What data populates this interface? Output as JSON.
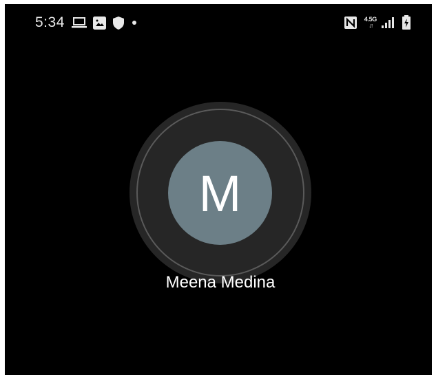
{
  "status_bar": {
    "time": "5:34",
    "left_icons": [
      "laptop-icon",
      "image-icon",
      "shield-icon",
      "dot-icon"
    ],
    "network_type": "4.5G",
    "network_arrows": "↓↑",
    "right_icons": [
      "nfc-icon",
      "signal-icon",
      "battery-charging-icon"
    ]
  },
  "contact": {
    "initial": "M",
    "name": "Meena Medina",
    "avatar_color": "#6c7f87"
  }
}
